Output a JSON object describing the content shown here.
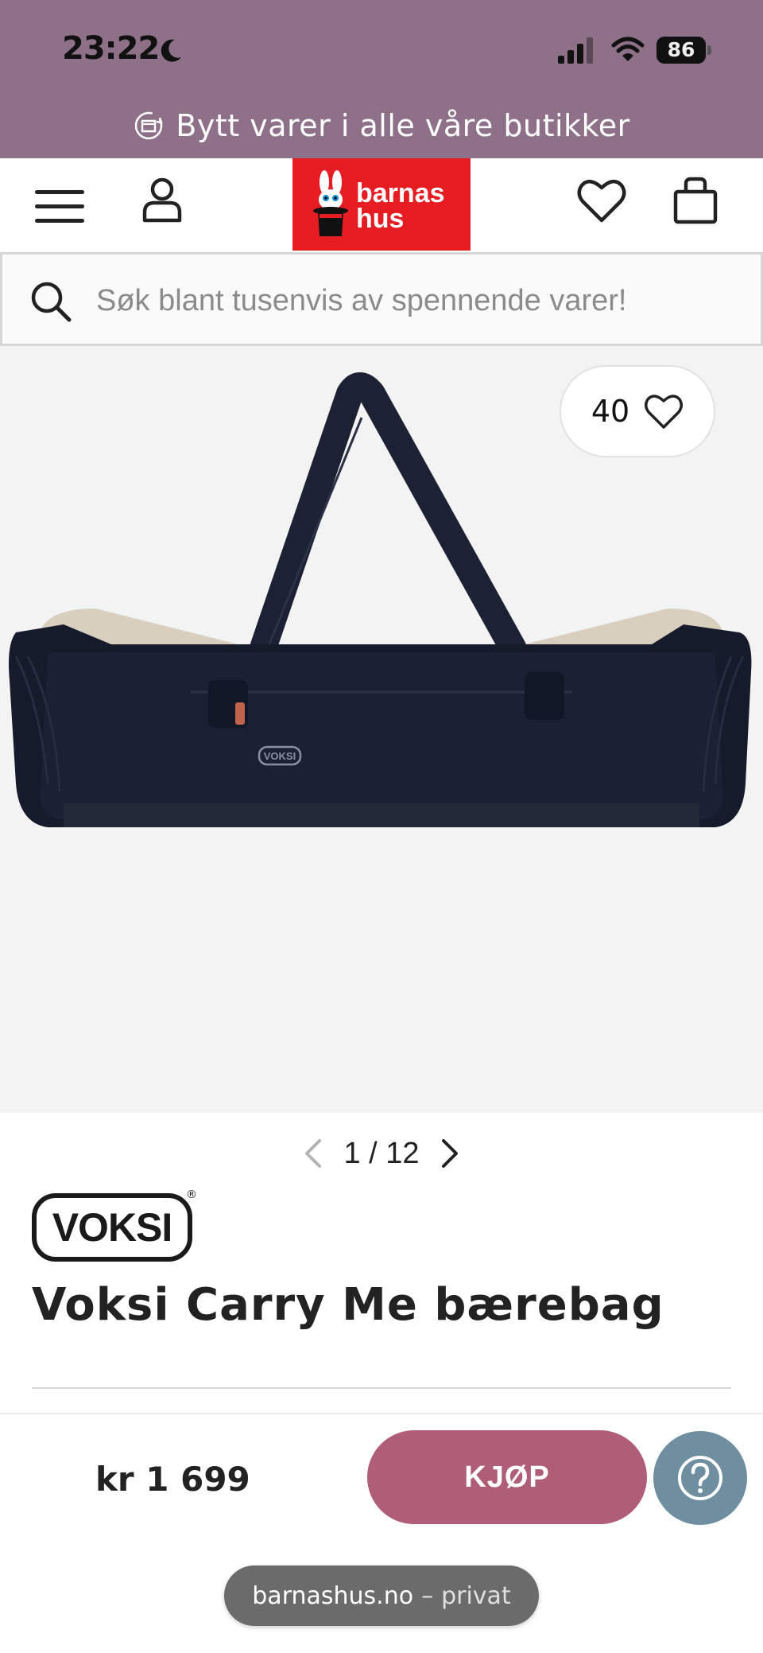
{
  "status_bar": {
    "time": "23:22",
    "battery": "86",
    "icons": [
      "moon-icon",
      "signal-icon",
      "wifi-icon",
      "battery-icon"
    ]
  },
  "promo": {
    "text": "Bytt varer i alle våre butikker",
    "icon": "exchange-box-icon"
  },
  "header": {
    "logo_line1": "barnas",
    "logo_line2": "hus",
    "icons": [
      "menu-icon",
      "user-icon",
      "heart-icon",
      "shopping-bag-icon"
    ]
  },
  "search": {
    "placeholder": "Søk blant tusenvis av spennende varer!"
  },
  "gallery": {
    "favorite_count": "40",
    "image_brand_mark": "VOKSI",
    "pager": "1 / 12"
  },
  "product": {
    "brand": "VOKSI",
    "title": "Voksi Carry Me bærebag"
  },
  "buybar": {
    "price": "kr 1 699",
    "buy_label": "KJØP"
  },
  "browser": {
    "domain": "barnashus.no",
    "separator": "–",
    "mode": "privat"
  },
  "colors": {
    "top_band": "#8e7188",
    "logo_red": "#e51c22",
    "buy_button": "#b05d78",
    "help_button": "#6f8fa1"
  }
}
